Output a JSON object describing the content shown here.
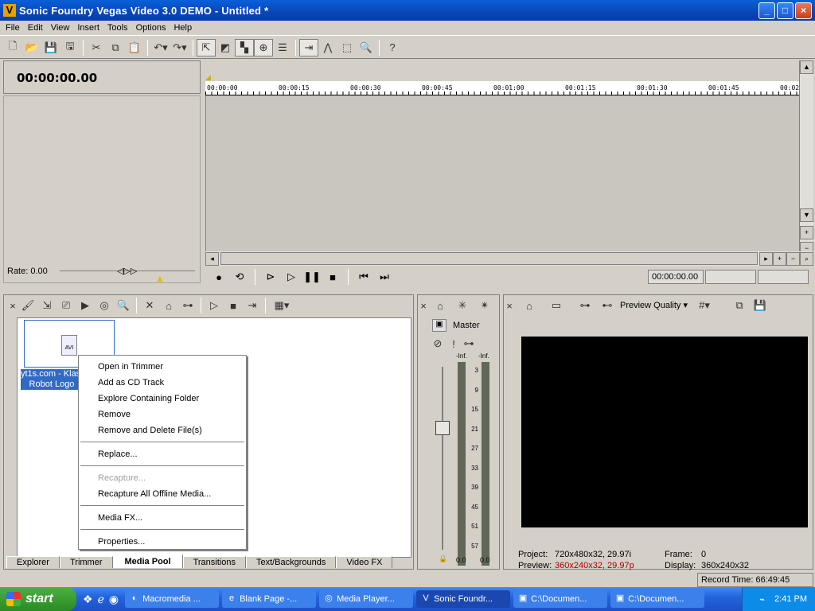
{
  "window": {
    "title": "Sonic Foundry Vegas Video 3.0 DEMO - Untitled *",
    "app_icon": "V",
    "buttons": {
      "minimize": "_",
      "maximize": "□",
      "close": "×"
    }
  },
  "menu": [
    "File",
    "Edit",
    "View",
    "Insert",
    "Tools",
    "Options",
    "Help"
  ],
  "toolbar_icons": [
    "new-icon",
    "open-icon",
    "save-icon",
    "save-as-icon",
    "cut-icon",
    "copy-icon",
    "paste-icon",
    "undo-icon",
    "redo-icon",
    "normal-edit-tool-icon",
    "envelope-tool-icon",
    "selection-tool-icon",
    "zoom-tool-icon",
    "snap-icon",
    "ripple-icon",
    "lock-icon",
    "auto-crossfade-icon",
    "help-icon"
  ],
  "timeline": {
    "cursor_time": "00:00:00.00",
    "ruler_labels": [
      "00:00:00",
      "00:00:15",
      "00:00:30",
      "00:00:45",
      "00:01:00",
      "00:01:15",
      "00:01:30",
      "00:01:45",
      "00:02"
    ],
    "rate": "Rate: 0.00",
    "transport_time": "00:00:00.00"
  },
  "media_pool": {
    "file_type": "AVI",
    "file_label_line1": "yt1s.com - Klask",
    "file_label_line2": "Robot Logo",
    "tabs": [
      "Explorer",
      "Trimmer",
      "Media Pool",
      "Transitions",
      "Text/Backgrounds",
      "Video FX"
    ],
    "active_tab": "Media Pool"
  },
  "context_menu": {
    "items": [
      {
        "label": "Open in Trimmer",
        "enabled": true
      },
      {
        "label": "Add as CD Track",
        "enabled": true
      },
      {
        "label": "Explore Containing Folder",
        "enabled": true
      },
      {
        "label": "Remove",
        "enabled": true
      },
      {
        "label": "Remove and Delete File(s)",
        "enabled": true
      },
      {
        "sep": true
      },
      {
        "label": "Replace...",
        "enabled": true
      },
      {
        "sep": true
      },
      {
        "label": "Recapture...",
        "enabled": false
      },
      {
        "label": "Recapture All Offline Media...",
        "enabled": true
      },
      {
        "sep": true
      },
      {
        "label": "Media FX...",
        "enabled": true
      },
      {
        "sep": true
      },
      {
        "label": "Properties...",
        "enabled": true
      }
    ]
  },
  "mixer": {
    "master_label": "Master",
    "inf_left": "-Inf.",
    "inf_right": "-Inf.",
    "scale": [
      "3",
      "9",
      "15",
      "21",
      "27",
      "33",
      "39",
      "45",
      "51",
      "57"
    ],
    "level_left": "0.0",
    "level_right": "0.0"
  },
  "preview": {
    "quality_label": "Preview Quality",
    "project_label": "Project:",
    "project_value": "720x480x32, 29.97i",
    "preview_label": "Preview:",
    "preview_value": "360x240x32, 29.97p",
    "frame_label": "Frame:",
    "frame_value": "0",
    "display_label": "Display:",
    "display_value": "360x240x32"
  },
  "status": {
    "record_time": "Record Time: 66:49:45"
  },
  "taskbar": {
    "start_label": "start",
    "tasks": [
      {
        "label": "Macromedia ...",
        "icon": "◐"
      },
      {
        "label": "Blank Page -...",
        "icon": "e"
      },
      {
        "label": "Media Player...",
        "icon": "◎"
      },
      {
        "label": "Sonic Foundr...",
        "icon": "V",
        "active": true
      },
      {
        "label": "C:\\Documen...",
        "icon": "▣"
      },
      {
        "label": "C:\\Documen...",
        "icon": "▣"
      }
    ],
    "time": "2:41 PM"
  }
}
